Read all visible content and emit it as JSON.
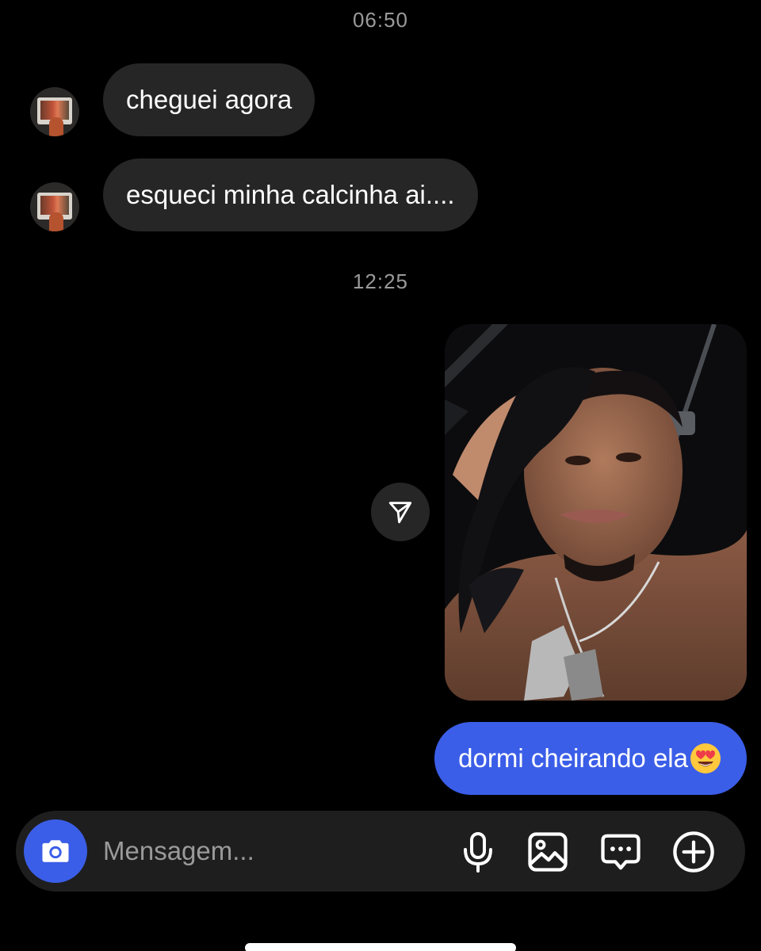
{
  "thread": {
    "timestamps": [
      "06:50",
      "12:25"
    ],
    "incoming": [
      {
        "text": "cheguei agora"
      },
      {
        "text": "esqueci minha calcinha ai...."
      }
    ],
    "outgoing": {
      "text": "dormi cheirando ela",
      "emoji": "smiling-face-with-heart-eyes"
    }
  },
  "composer": {
    "placeholder": "Mensagem...",
    "icons": [
      "camera-icon",
      "microphone-icon",
      "gallery-icon",
      "sticker-chat-icon",
      "plus-circle-icon"
    ]
  },
  "colors": {
    "background": "#000000",
    "incoming_bubble": "#262626",
    "outgoing_bubble": "#3b5ee8",
    "timestamp": "#9a9a9a",
    "composer": "#1e1e1e"
  }
}
